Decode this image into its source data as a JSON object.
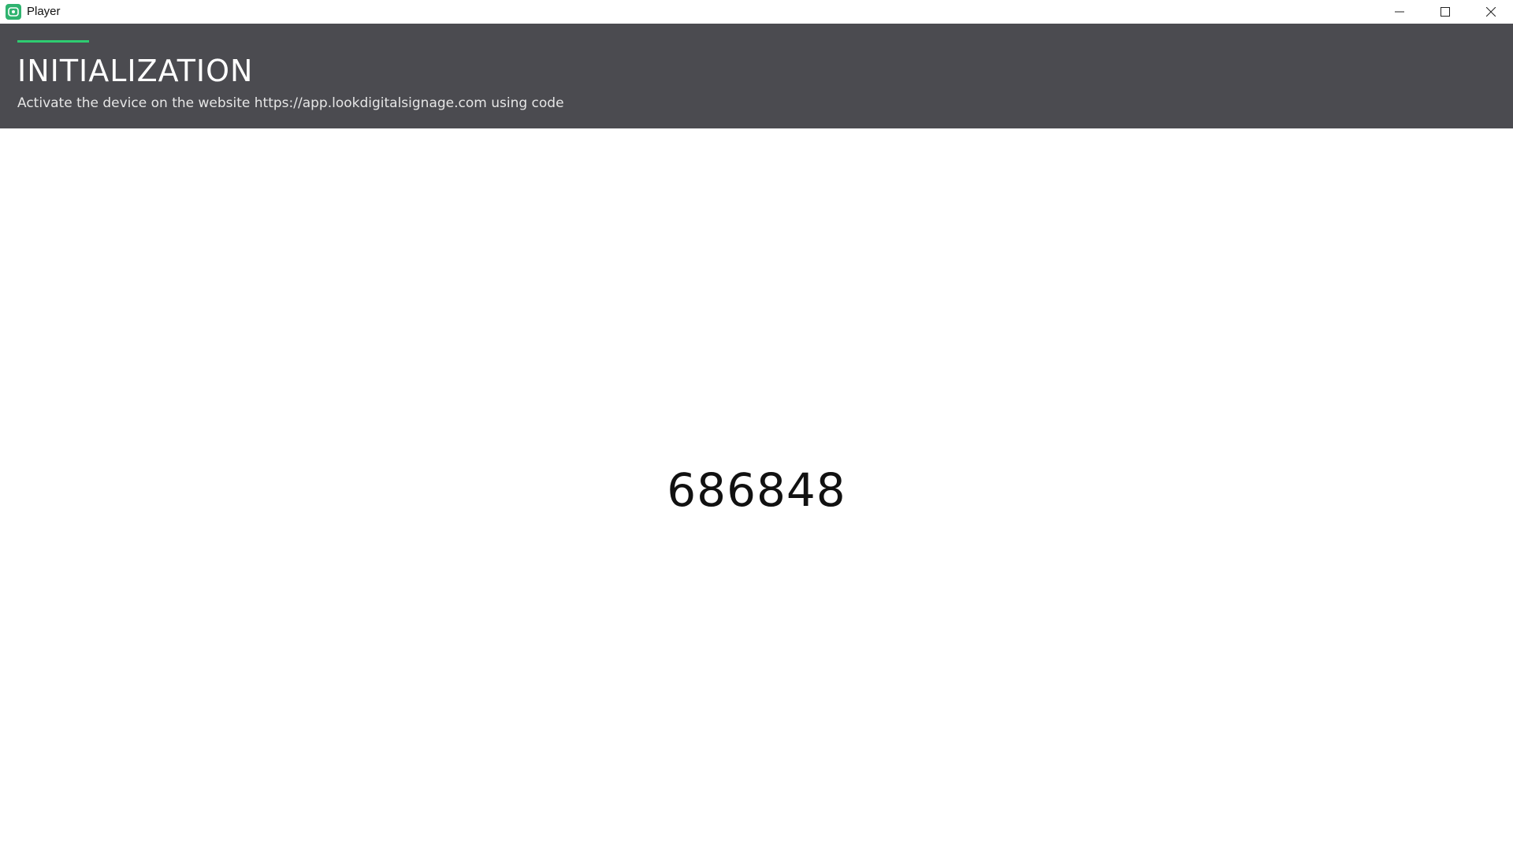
{
  "window": {
    "title": "Player",
    "app_icon": "player-app-icon",
    "controls": {
      "minimize_icon": "minimize-icon",
      "maximize_icon": "maximize-icon",
      "close_icon": "close-icon"
    }
  },
  "header": {
    "title": "INITIALIZATION",
    "subtitle": "Activate the device on the website https://app.lookdigitalsignage.com using code"
  },
  "main": {
    "activation_code": "686848"
  },
  "colors": {
    "header_background": "#4b4b50",
    "accent": "#2ecc71",
    "app_icon": "#2fb36f"
  }
}
